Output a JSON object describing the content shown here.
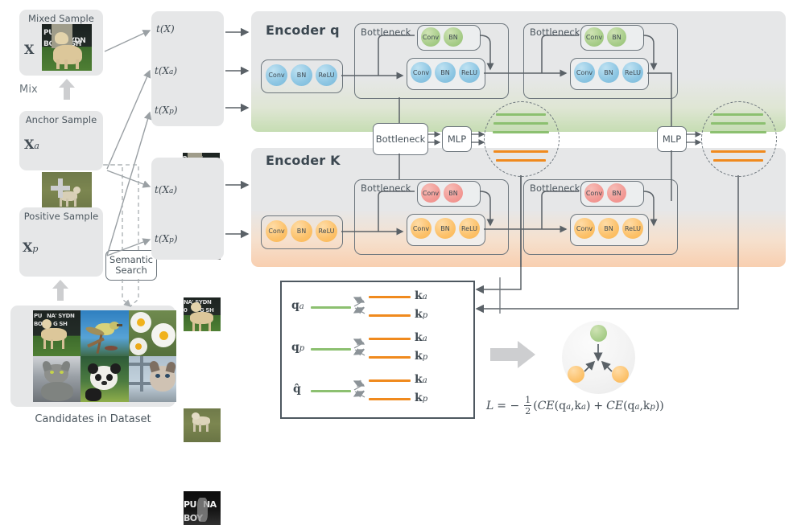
{
  "title": "Contrastive learning framework with mixed, anchor and positive samples",
  "left_column": {
    "mixed_sample": {
      "label": "Mixed Sample",
      "symbol": "X"
    },
    "mix_label": "Mix",
    "mix_arrow_icon": "up-arrow-icon",
    "anchor_sample": {
      "label": "Anchor Sample",
      "symbol": "Xa"
    },
    "plus_icon": "plus-icon",
    "positive_sample": {
      "label": "Positive Sample",
      "symbol": "Xp"
    },
    "positive_arrow_icon": "up-arrow-icon",
    "semantic_search": {
      "line1": "Semantic",
      "line2": "Search"
    },
    "candidates_caption": "Candidates in Dataset",
    "candidates": [
      {
        "name": "dog-thumbnail"
      },
      {
        "name": "bird-thumbnail"
      },
      {
        "name": "daisy-thumbnail"
      },
      {
        "name": "cat-thumbnail"
      },
      {
        "name": "panda-thumbnail"
      },
      {
        "name": "siamese-cat-thumbnail"
      }
    ]
  },
  "transform_top": {
    "items": [
      {
        "label": "t(X)",
        "sub": "",
        "thumb": "mixed-dog-thumbnail"
      },
      {
        "label": "t(X",
        "sub": "a",
        "thumb": "gray-anchor-thumbnail"
      },
      {
        "label": "t(X",
        "sub": "p",
        "thumb": "positive-dog-thumbnail"
      }
    ]
  },
  "transform_bottom": {
    "items": [
      {
        "label": "t(X",
        "sub": "a",
        "thumb": "anchor-dog-thumbnail"
      },
      {
        "label": "t(X",
        "sub": "p",
        "thumb": "dark-sign-thumbnail"
      }
    ]
  },
  "encoder_q": {
    "title": "Encoder q",
    "accent": "#a8cd8a",
    "stem": {
      "blocks": [
        "Conv",
        "BN",
        "ReLU"
      ]
    },
    "bottlenecks": [
      {
        "label": "Bottleneck",
        "shortcut": [
          "Conv",
          "BN"
        ],
        "main": [
          "Conv",
          "BN",
          "ReLU"
        ]
      },
      {
        "label": "Bottleneck",
        "shortcut": [
          "Conv",
          "BN"
        ],
        "main": [
          "Conv",
          "BN",
          "ReLU"
        ]
      }
    ]
  },
  "encoder_k": {
    "title": "Encoder K",
    "accent": "#fbb74f",
    "stem": {
      "blocks": [
        "Conv",
        "BN",
        "ReLU"
      ]
    },
    "bottlenecks": [
      {
        "label": "Bottleneck",
        "shortcut": [
          "Conv",
          "BN"
        ],
        "main": [
          "Conv",
          "BN",
          "ReLU"
        ]
      },
      {
        "label": "Bottleneck",
        "shortcut": [
          "Conv",
          "BN"
        ],
        "main": [
          "Conv",
          "BN",
          "ReLU"
        ]
      }
    ]
  },
  "mid_connector": {
    "bottleneck_label": "Bottleneck",
    "mlp_label": "MLP"
  },
  "right_connector": {
    "mlp_label": "MLP"
  },
  "feature_circles": {
    "left": {
      "green_lines": 3,
      "orange_lines": 2
    },
    "right": {
      "green_lines": 3,
      "orange_lines": 2
    }
  },
  "loss_box": {
    "rows": [
      {
        "q": "q",
        "q_sub": "a",
        "keys": [
          {
            "k": "k",
            "sub": "a"
          },
          {
            "k": "k",
            "sub": "p"
          }
        ]
      },
      {
        "q": "q",
        "q_sub": "p",
        "keys": [
          {
            "k": "k",
            "sub": "a"
          },
          {
            "k": "k",
            "sub": "p"
          }
        ]
      },
      {
        "q": "q̂",
        "q_sub": "",
        "keys": [
          {
            "k": "k",
            "sub": "a"
          },
          {
            "k": "k",
            "sub": "p"
          }
        ]
      }
    ],
    "q_color": "#8cc070",
    "k_color": "#f08a1e"
  },
  "sphere": {
    "arrow_icon": "big-right-arrow-icon",
    "green_dot": "query-embedding-dot",
    "orange_dots": [
      "key-embedding-dot-a",
      "key-embedding-dot-p"
    ]
  },
  "formula": {
    "text": "L = -  (CE(q  ,k  ) + CE(q  ,k  ))",
    "lhs": "L",
    "eq": "= −",
    "num": "1",
    "den": "2",
    "body_open": "(",
    "ce1": "CE",
    "ce1_args": "(q  ,k  )",
    "plus": "+",
    "ce2": "CE",
    "ce2_args": "(q  ,k  )",
    "body_close": ")"
  }
}
